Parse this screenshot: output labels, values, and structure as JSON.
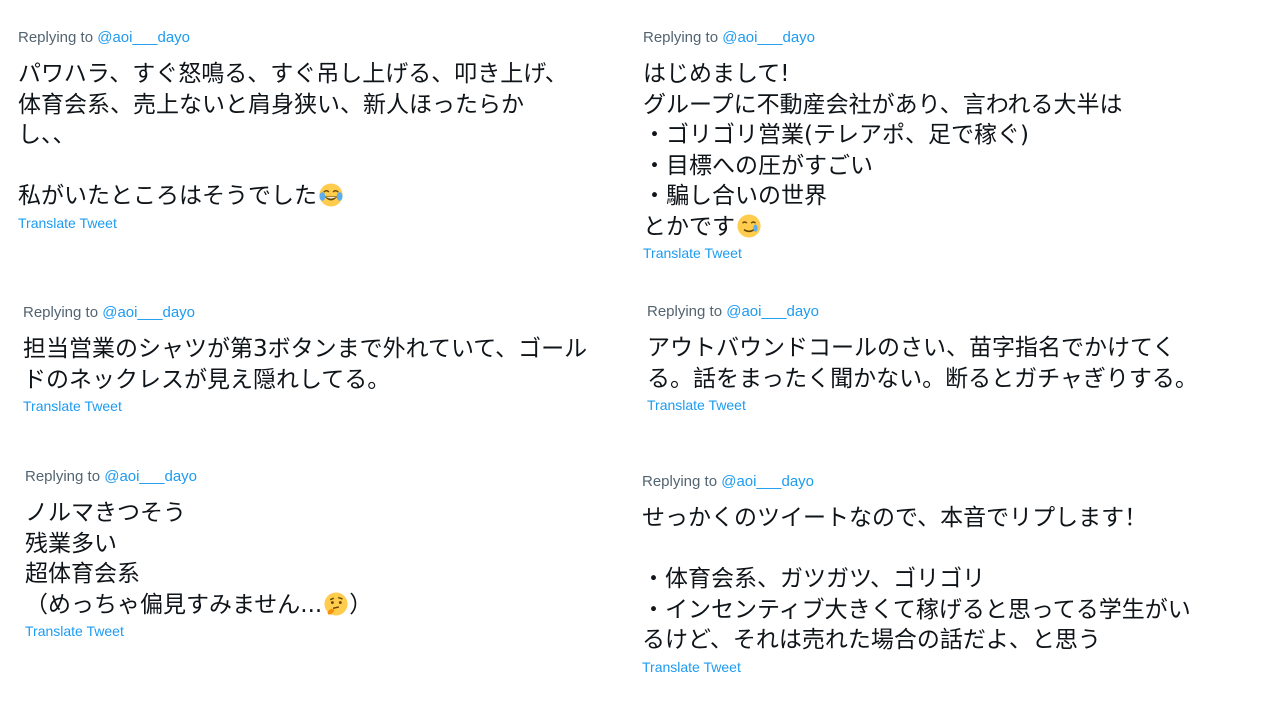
{
  "tweets": [
    {
      "reply_prefix": "Replying to",
      "handle": "@aoi___dayo",
      "text": "パワハラ、すぐ怒鳴る、すぐ吊し上げる、叩き上げ、\n体育会系、売上ないと肩身狭い、新人ほったらか\nし、、\n\n私がいたところはそうでした",
      "emoji": "face-with-tears-of-joy",
      "translate": "Translate Tweet"
    },
    {
      "reply_prefix": "Replying to",
      "handle": "@aoi___dayo",
      "text": "はじめまして!\nグループに不動産会社があり、言われる大半は\n・ゴリゴリ営業(テレアポ、足で稼ぐ)\n・目標への圧がすごい\n・騙し合いの世界\nとかです",
      "emoji": "smiling-face-with-tear",
      "translate": "Translate Tweet"
    },
    {
      "reply_prefix": "Replying to",
      "handle": "@aoi___dayo",
      "text": "担当営業のシャツが第3ボタンまで外れていて、ゴール\nドのネックレスが見え隠れしてる。",
      "translate": "Translate Tweet"
    },
    {
      "reply_prefix": "Replying to",
      "handle": "@aoi___dayo",
      "text": "アウトバウンドコールのさい、苗字指名でかけてく\nる。話をまったく聞かない。断るとガチャぎりする。",
      "translate": "Translate Tweet"
    },
    {
      "reply_prefix": "Replying to",
      "handle": "@aoi___dayo",
      "text": "ノルマきつそう\n残業多い\n超体育会系\n（めっちゃ偏見すみません...",
      "text_after": "）",
      "emoji": "thinking-face",
      "translate": "Translate Tweet"
    },
    {
      "reply_prefix": "Replying to",
      "handle": "@aoi___dayo",
      "text": "せっかくのツイートなので、本音でリプします！\n\n・体育会系、ガツガツ、ゴリゴリ\n・インセンティブ大きくて稼げると思ってる学生がい\nるけど、それは売れた場合の話だよ、と思う",
      "translate": "Translate Tweet"
    }
  ],
  "colors": {
    "link": "#1d9bf0",
    "muted": "#536471",
    "text": "#0f1419"
  }
}
